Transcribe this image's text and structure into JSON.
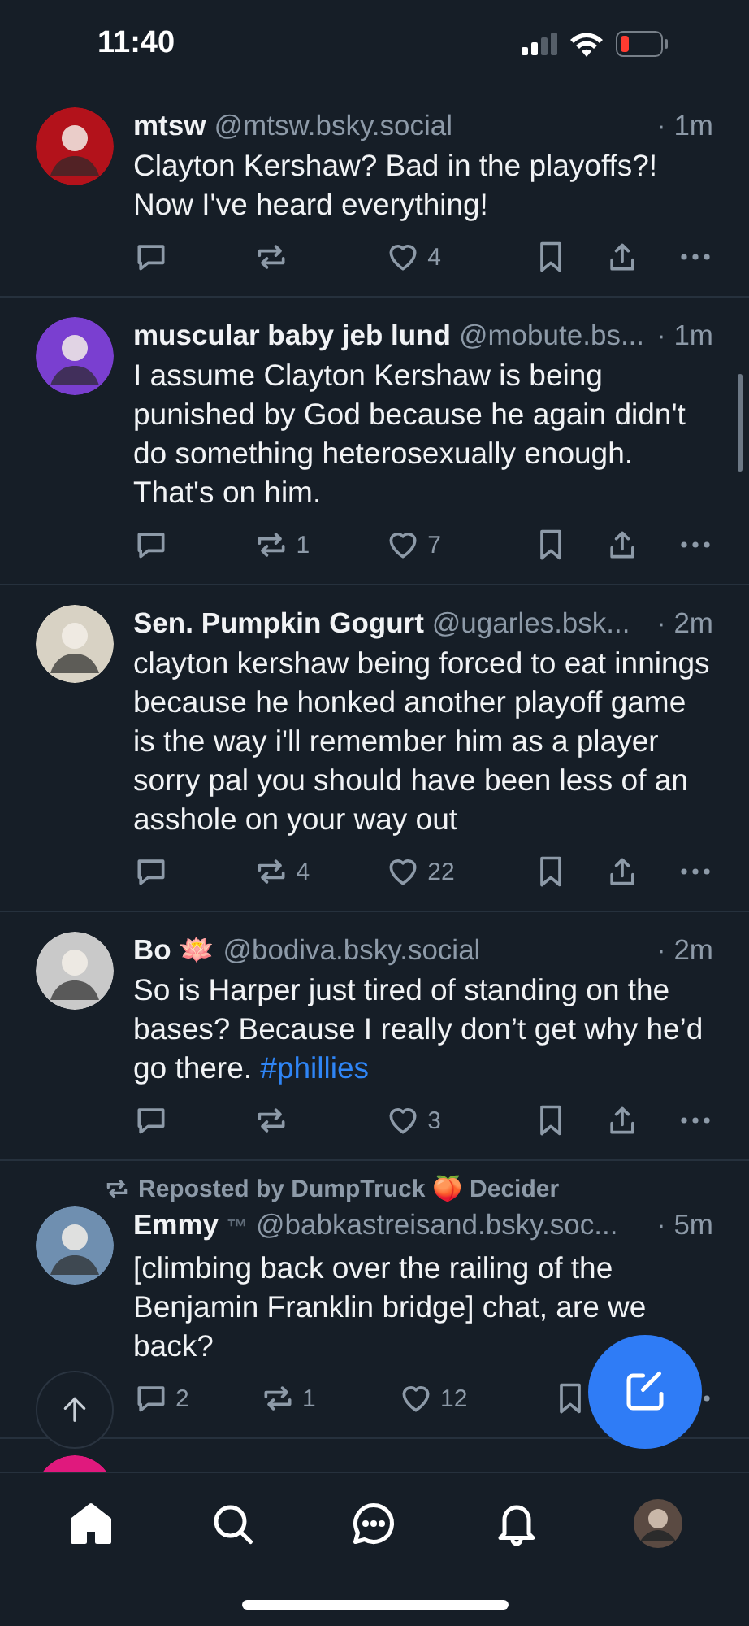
{
  "status_bar": {
    "time": "11:40"
  },
  "posts": [
    {
      "kind": "post",
      "name": "mtsw",
      "handle": "@mtsw.bsky.social",
      "time": "· 1m",
      "body": [
        {
          "kind": "plain",
          "text": "Clayton Kershaw? Bad in the playoffs?! Now I've heard everything!"
        }
      ],
      "actions": [
        {
          "kind": "reply"
        },
        {
          "kind": "repost"
        },
        {
          "kind": "like",
          "count": "4"
        },
        {
          "kind": "bookmark"
        },
        {
          "kind": "share"
        },
        {
          "kind": "more"
        }
      ]
    },
    {
      "kind": "post",
      "name": "muscular baby jeb lund",
      "handle": "@mobute.bs...",
      "time": "· 1m",
      "body": [
        {
          "kind": "plain",
          "text": "I assume Clayton Kershaw is being punished by God because he again didn't do something heterosexually enough. That's on him."
        }
      ],
      "actions": [
        {
          "kind": "reply"
        },
        {
          "kind": "repost",
          "count": "1"
        },
        {
          "kind": "like",
          "count": "7"
        },
        {
          "kind": "bookmark"
        },
        {
          "kind": "share"
        },
        {
          "kind": "more"
        }
      ]
    },
    {
      "kind": "post",
      "name": "Sen. Pumpkin Gogurt",
      "handle": "@ugarles.bsk...",
      "time": "· 2m",
      "body": [
        {
          "kind": "plain",
          "text": "clayton kershaw being forced to eat innings because he honked another playoff game is the way i'll remember him as a player sorry pal you should have been less of an asshole on your way out"
        }
      ],
      "actions": [
        {
          "kind": "reply"
        },
        {
          "kind": "repost",
          "count": "4"
        },
        {
          "kind": "like",
          "count": "22"
        },
        {
          "kind": "bookmark"
        },
        {
          "kind": "share"
        },
        {
          "kind": "more"
        }
      ]
    },
    {
      "kind": "post",
      "name": "Bo 🪷",
      "handle": "@bodiva.bsky.social",
      "time": "· 2m",
      "body": [
        {
          "kind": "plain",
          "text": "So is Harper just tired of standing on the bases? Because I really don’t get why he’d go there. "
        },
        {
          "kind": "hashtag",
          "text": "#phillies"
        }
      ],
      "actions": [
        {
          "kind": "reply"
        },
        {
          "kind": "repost"
        },
        {
          "kind": "like",
          "count": "3"
        },
        {
          "kind": "bookmark"
        },
        {
          "kind": "share"
        },
        {
          "kind": "more"
        }
      ]
    },
    {
      "kind": "post",
      "reposted_by": "Reposted by DumpTruck 🍑 Decider",
      "name": "Emmy",
      "name_suffix": "™",
      "handle": "@babkastreisand.bsky.soc...",
      "time": "· 5m",
      "body": [
        {
          "kind": "plain",
          "text": "[climbing back over the railing of the Benjamin Franklin bridge] chat, are we back?"
        }
      ],
      "actions": [
        {
          "kind": "reply",
          "count": "2"
        },
        {
          "kind": "repost",
          "count": "1"
        },
        {
          "kind": "like",
          "count": "12"
        },
        {
          "kind": "bookmark"
        },
        {
          "kind": "more"
        }
      ]
    },
    {
      "kind": "cut_off"
    }
  ],
  "nav": [
    {
      "kind": "home",
      "selected": true
    },
    {
      "kind": "search",
      "selected": false
    },
    {
      "kind": "chat",
      "selected": false
    },
    {
      "kind": "bell",
      "selected": false
    },
    {
      "kind": "profile",
      "selected": false
    }
  ]
}
